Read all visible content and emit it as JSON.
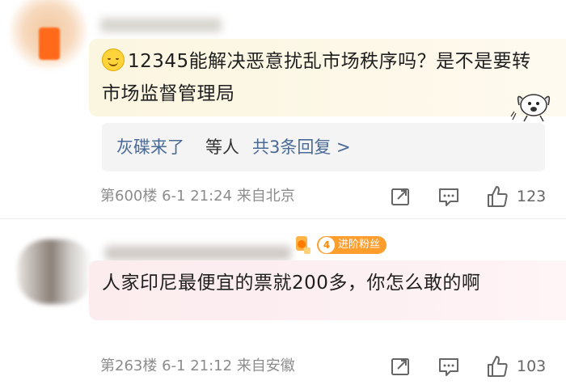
{
  "comments": [
    {
      "text": "12345能解决恶意扰乱市场秩序吗？是不是要转市场监督管理局",
      "replies": {
        "user": "灰碟来了",
        "action": "等人",
        "more": "共3条回复 >"
      },
      "meta": "第600楼 6-1 21:24 来自北京",
      "likes": "123"
    },
    {
      "badge": {
        "level": "4",
        "label": "进阶粉丝"
      },
      "text": "人家印尼最便宜的票就200多，你怎么敢的啊",
      "meta": "第263楼 6-1 21:12 来自安徽",
      "likes": "103"
    }
  ],
  "colors": {
    "link": "#4a6a96",
    "meta": "#8c8c8c",
    "badge": "#ff9e2c",
    "emoji": "#ffd43b"
  },
  "icons": [
    "smile-emoji-icon",
    "dog-sticker-icon",
    "share-icon",
    "comment-icon",
    "like-icon",
    "fan-medal-icon"
  ]
}
